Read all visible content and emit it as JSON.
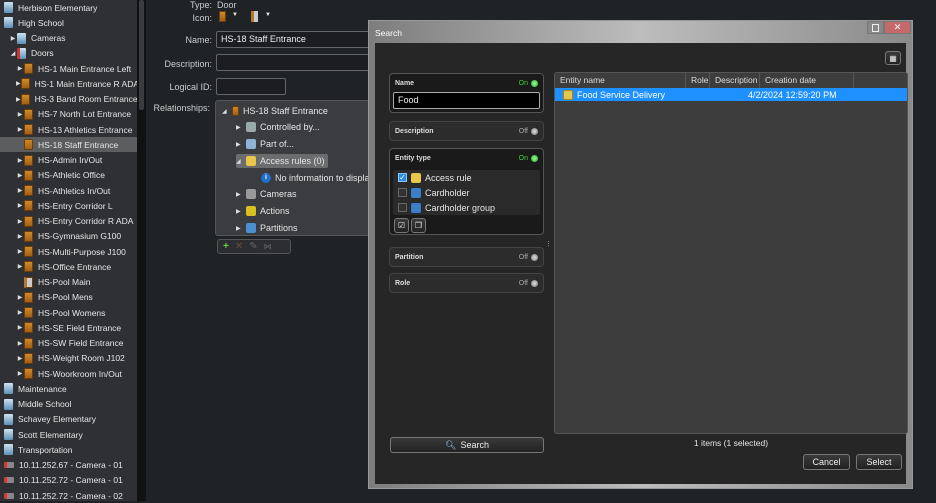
{
  "tree": [
    {
      "label": "Herbison Elementary",
      "icon": "building",
      "indent": 0,
      "arrow": ""
    },
    {
      "label": "High School",
      "icon": "building",
      "indent": 0,
      "arrow": ""
    },
    {
      "label": "Cameras",
      "icon": "building",
      "indent": 1,
      "arrow": "collapsed"
    },
    {
      "label": "Doors",
      "icon": "building-door",
      "indent": 1,
      "arrow": "expanded"
    },
    {
      "label": "HS-1 Main Entrance Left",
      "icon": "door",
      "indent": 2,
      "arrow": "collapsed"
    },
    {
      "label": "HS-1 Main Entrance R ADA",
      "icon": "door",
      "indent": 2,
      "arrow": "collapsed"
    },
    {
      "label": "HS-3 Band Room Entrance",
      "icon": "door",
      "indent": 2,
      "arrow": "collapsed"
    },
    {
      "label": "HS-7 North Lot Entrance",
      "icon": "door",
      "indent": 2,
      "arrow": "collapsed"
    },
    {
      "label": "HS-13 Athletics Entrance",
      "icon": "door",
      "indent": 2,
      "arrow": "collapsed"
    },
    {
      "label": "HS-18 Staff Entrance",
      "icon": "door",
      "indent": 2,
      "arrow": "",
      "selected": true
    },
    {
      "label": "HS-Admin In/Out",
      "icon": "door",
      "indent": 2,
      "arrow": "collapsed"
    },
    {
      "label": "HS-Athletic Office",
      "icon": "door",
      "indent": 2,
      "arrow": "collapsed"
    },
    {
      "label": "HS-Athletics In/Out",
      "icon": "door",
      "indent": 2,
      "arrow": "collapsed"
    },
    {
      "label": "HS-Entry Corridor L",
      "icon": "door",
      "indent": 2,
      "arrow": "collapsed"
    },
    {
      "label": "HS-Entry Corridor R ADA",
      "icon": "door",
      "indent": 2,
      "arrow": "collapsed"
    },
    {
      "label": "HS-Gymnasium G100",
      "icon": "door",
      "indent": 2,
      "arrow": "collapsed"
    },
    {
      "label": "HS-Multi-Purpose J100",
      "icon": "door",
      "indent": 2,
      "arrow": "collapsed"
    },
    {
      "label": "HS-Office Entrance",
      "icon": "door",
      "indent": 2,
      "arrow": "collapsed"
    },
    {
      "label": "HS-Pool Main",
      "icon": "door-open",
      "indent": 2,
      "arrow": ""
    },
    {
      "label": "HS-Pool Mens",
      "icon": "door",
      "indent": 2,
      "arrow": "collapsed"
    },
    {
      "label": "HS-Pool Womens",
      "icon": "door",
      "indent": 2,
      "arrow": "collapsed"
    },
    {
      "label": "HS-SE Field Entrance",
      "icon": "door",
      "indent": 2,
      "arrow": "collapsed"
    },
    {
      "label": "HS-SW Field Entrance",
      "icon": "door",
      "indent": 2,
      "arrow": "collapsed"
    },
    {
      "label": "HS-Weight Room J102",
      "icon": "door",
      "indent": 2,
      "arrow": "collapsed"
    },
    {
      "label": "HS-Woorkroom In/Out",
      "icon": "door",
      "indent": 2,
      "arrow": "collapsed"
    },
    {
      "label": "Maintenance",
      "icon": "building",
      "indent": 0,
      "arrow": ""
    },
    {
      "label": "Middle School",
      "icon": "building",
      "indent": 0,
      "arrow": ""
    },
    {
      "label": "Schavey Elementary",
      "icon": "building",
      "indent": 0,
      "arrow": ""
    },
    {
      "label": "Scott Elementary",
      "icon": "building",
      "indent": 0,
      "arrow": ""
    },
    {
      "label": "Transportation",
      "icon": "building",
      "indent": 0,
      "arrow": ""
    },
    {
      "label": "10.11.252.67 - Camera - 01",
      "icon": "camera",
      "indent": 0,
      "arrow": ""
    },
    {
      "label": "10.11.252.72 - Camera - 01",
      "icon": "camera",
      "indent": 0,
      "arrow": ""
    },
    {
      "label": "10.11.252.72 - Camera - 02",
      "icon": "camera",
      "indent": 0,
      "arrow": ""
    }
  ],
  "props": {
    "type_label": "Type:",
    "type_value": "Door",
    "icon_label": "Icon:",
    "name_label": "Name:",
    "name_value": "HS-18 Staff Entrance",
    "description_label": "Description:",
    "description_value": "",
    "logical_id_label": "Logical ID:",
    "logical_id_value": "",
    "relationships_label": "Relationships:",
    "relationships": {
      "root": "HS-18 Staff Entrance",
      "items": [
        {
          "label": "Controlled by...",
          "icon": "controller"
        },
        {
          "label": "Part of...",
          "icon": "building"
        },
        {
          "label": "Access rules (0)",
          "icon": "access-rule",
          "expanded": true
        },
        {
          "label": "Cameras",
          "icon": "camera"
        },
        {
          "label": "Actions",
          "icon": "actions"
        },
        {
          "label": "Partitions",
          "icon": "partition"
        }
      ],
      "empty_message": "No information to display"
    }
  },
  "dialog": {
    "title": "Search",
    "filters": {
      "name": {
        "label": "Name",
        "state": "On",
        "value": "Food"
      },
      "description": {
        "label": "Description",
        "state": "Off"
      },
      "entity_type": {
        "label": "Entity type",
        "state": "On",
        "options": [
          {
            "label": "Access rule",
            "checked": true
          },
          {
            "label": "Cardholder",
            "checked": false
          },
          {
            "label": "Cardholder group",
            "checked": false
          }
        ]
      },
      "partition": {
        "label": "Partition",
        "state": "Off"
      },
      "role": {
        "label": "Role",
        "state": "Off"
      }
    },
    "search_button": "Search",
    "columns": [
      "Entity name",
      "Role",
      "Description",
      "Creation date"
    ],
    "results": [
      {
        "name": "Food Service Delivery",
        "role": "",
        "description": "",
        "created": "4/2/2024 12:59:20 PM",
        "selected": true
      }
    ],
    "status": "1 items (1 selected)",
    "cancel": "Cancel",
    "select": "Select"
  },
  "colors": {
    "on": "#3cd23c",
    "off": "#9a9a9a",
    "selection": "#1e90ff"
  }
}
